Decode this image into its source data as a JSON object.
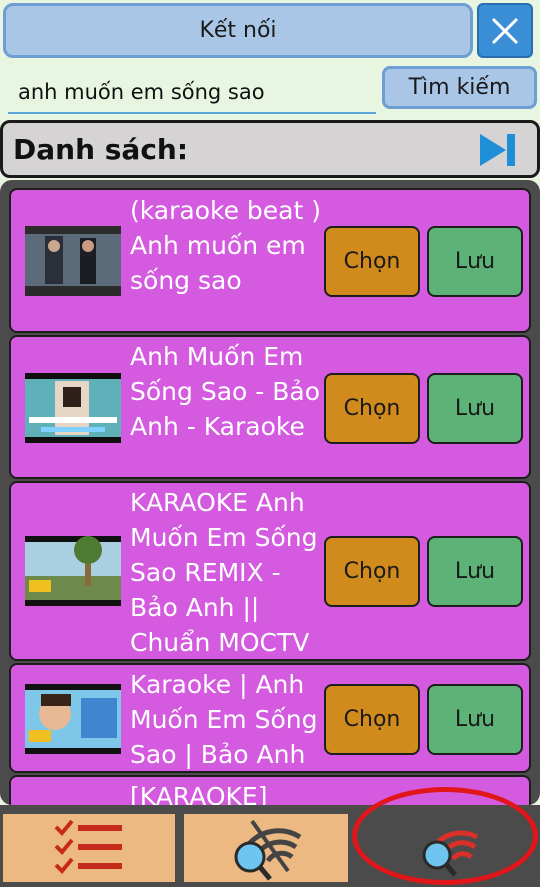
{
  "header": {
    "connect_label": "Kết nối",
    "close_icon": "close-icon"
  },
  "search": {
    "value": "anh muốn em sống sao",
    "button_label": "Tìm kiếm"
  },
  "list": {
    "title": "Danh sách:",
    "skip_icon": "skip-next-icon",
    "items": [
      {
        "title": "(karaoke beat ) Anh muốn em sống sao",
        "choose_label": "Chọn",
        "save_label": "Lưu"
      },
      {
        "title": "Anh Muốn Em Sống Sao - Bảo Anh - Karaoke",
        "choose_label": "Chọn",
        "save_label": "Lưu"
      },
      {
        "title": "KARAOKE Anh Muốn Em Sống Sao REMIX - Bảo Anh || Chuẩn MOCTV",
        "choose_label": "Chọn",
        "save_label": "Lưu"
      },
      {
        "title": "Karaoke | Anh Muốn Em Sống Sao | Bảo Anh",
        "choose_label": "Chọn",
        "save_label": "Lưu"
      },
      {
        "title": "[KARAOKE]",
        "choose_label": "",
        "save_label": ""
      }
    ]
  },
  "bottom_tabs": [
    {
      "icon": "checklist-icon"
    },
    {
      "icon": "search-offline-icon"
    },
    {
      "icon": "search-online-icon",
      "active": true
    }
  ],
  "colors": {
    "row_bg": "#d45be0",
    "choose_bg": "#d18a1c",
    "save_bg": "#5db277",
    "highlight": "#e0161a"
  }
}
